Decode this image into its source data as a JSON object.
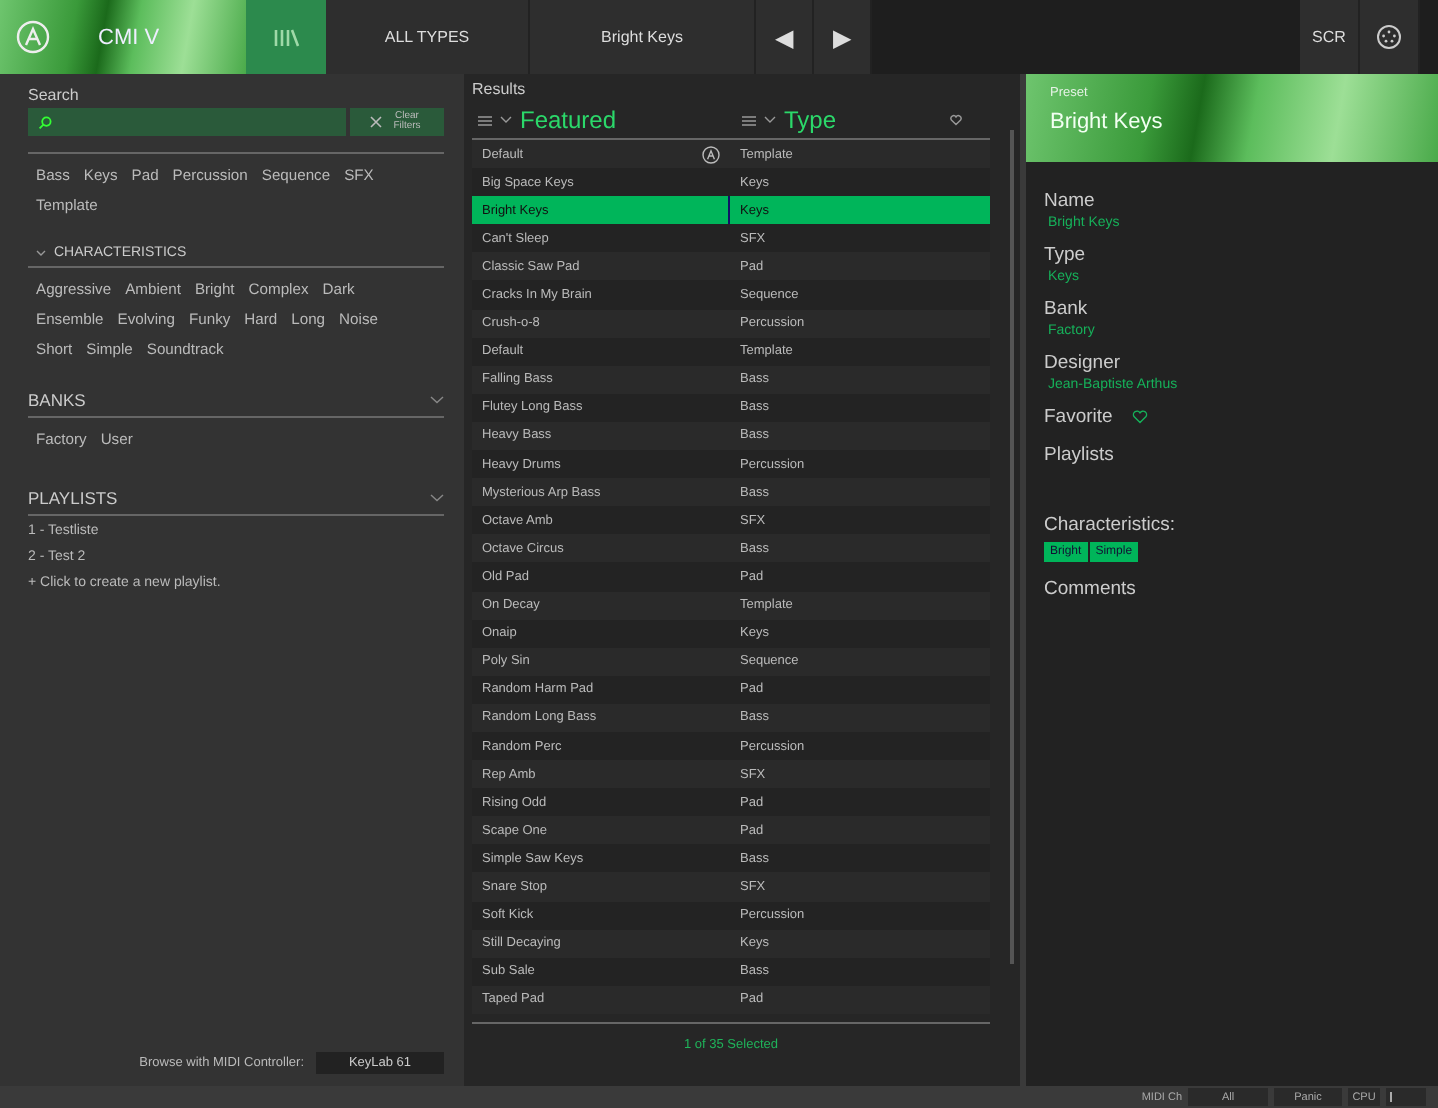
{
  "top_bar": {
    "instrument": "CMI V",
    "type_filter": "ALL TYPES",
    "preset": "Bright Keys",
    "prev": "◀",
    "next": "▶",
    "scr": "SCR"
  },
  "sidebar": {
    "search_label": "Search",
    "clear_filters": "Clear Filters",
    "types": [
      "Bass",
      "Keys",
      "Pad",
      "Percussion",
      "Sequence",
      "SFX",
      "Template"
    ],
    "characteristics": {
      "title": "CHARACTERISTICS",
      "expanded": true,
      "items": [
        "Aggressive",
        "Ambient",
        "Bright",
        "Complex",
        "Dark",
        "Ensemble",
        "Evolving",
        "Funky",
        "Hard",
        "Long",
        "Noise",
        "Short",
        "Simple",
        "Soundtrack"
      ]
    },
    "banks": {
      "title": "BANKS",
      "items": [
        "Factory",
        "User"
      ]
    },
    "playlists": {
      "title": "PLAYLISTS",
      "items": [
        "1 - Testliste",
        "2 - Test 2"
      ],
      "create": "+ Click to create a new playlist."
    },
    "midi_label": "Browse with MIDI Controller:",
    "midi_controller": "KeyLab 61"
  },
  "results": {
    "title": "Results",
    "columns": [
      "Featured",
      "Type"
    ],
    "rows": [
      {
        "name": "Default",
        "type": "Template",
        "selected": false,
        "factory": true
      },
      {
        "name": "Big Space Keys",
        "type": "Keys",
        "selected": false,
        "factory": false
      },
      {
        "name": "Bright Keys",
        "type": "Keys",
        "selected": true,
        "factory": false
      },
      {
        "name": "Can't Sleep",
        "type": "SFX",
        "selected": false,
        "factory": false
      },
      {
        "name": "Classic Saw Pad",
        "type": "Pad",
        "selected": false,
        "factory": false
      },
      {
        "name": "Cracks In My Brain",
        "type": "Sequence",
        "selected": false,
        "factory": false
      },
      {
        "name": "Crush-o-8",
        "type": "Percussion",
        "selected": false,
        "factory": false
      },
      {
        "name": "Default",
        "type": "Template",
        "selected": false,
        "factory": false
      },
      {
        "name": "Falling Bass",
        "type": "Bass",
        "selected": false,
        "factory": false
      },
      {
        "name": "Flutey Long Bass",
        "type": "Bass",
        "selected": false,
        "factory": false
      },
      {
        "name": "Heavy Bass",
        "type": "Bass",
        "selected": false,
        "factory": false
      },
      {
        "name": "Heavy Drums",
        "type": "Percussion",
        "selected": false,
        "factory": false
      },
      {
        "name": "Mysterious Arp Bass",
        "type": "Bass",
        "selected": false,
        "factory": false
      },
      {
        "name": "Octave Amb",
        "type": "SFX",
        "selected": false,
        "factory": false
      },
      {
        "name": "Octave Circus",
        "type": "Bass",
        "selected": false,
        "factory": false
      },
      {
        "name": "Old Pad",
        "type": "Pad",
        "selected": false,
        "factory": false
      },
      {
        "name": "On Decay",
        "type": "Template",
        "selected": false,
        "factory": false
      },
      {
        "name": "Onaip",
        "type": "Keys",
        "selected": false,
        "factory": false
      },
      {
        "name": "Poly Sin",
        "type": "Sequence",
        "selected": false,
        "factory": false
      },
      {
        "name": "Random Harm Pad",
        "type": "Pad",
        "selected": false,
        "factory": false
      },
      {
        "name": "Random Long Bass",
        "type": "Bass",
        "selected": false,
        "factory": false
      },
      {
        "name": "Random Perc",
        "type": "Percussion",
        "selected": false,
        "factory": false
      },
      {
        "name": "Rep Amb",
        "type": "SFX",
        "selected": false,
        "factory": false
      },
      {
        "name": "Rising Odd",
        "type": "Pad",
        "selected": false,
        "factory": false
      },
      {
        "name": "Scape One",
        "type": "Pad",
        "selected": false,
        "factory": false
      },
      {
        "name": "Simple Saw Keys",
        "type": "Bass",
        "selected": false,
        "factory": false
      },
      {
        "name": "Snare Stop",
        "type": "SFX",
        "selected": false,
        "factory": false
      },
      {
        "name": "Soft Kick",
        "type": "Percussion",
        "selected": false,
        "factory": false
      },
      {
        "name": "Still Decaying",
        "type": "Keys",
        "selected": false,
        "factory": false
      },
      {
        "name": "Sub Sale",
        "type": "Bass",
        "selected": false,
        "factory": false
      },
      {
        "name": "Taped Pad",
        "type": "Pad",
        "selected": false,
        "factory": false
      }
    ],
    "footer": "1 of 35 Selected"
  },
  "preset": {
    "header_label": "Preset",
    "header_name": "Bright Keys",
    "fields": [
      {
        "label": "Name",
        "value": "Bright Keys"
      },
      {
        "label": "Type",
        "value": "Keys"
      },
      {
        "label": "Bank",
        "value": "Factory"
      },
      {
        "label": "Designer",
        "value": "Jean-Baptiste Arthus"
      }
    ],
    "favorite_label": "Favorite",
    "favorite": false,
    "playlists_label": "Playlists",
    "characteristics_label": "Characteristics:",
    "characteristics": [
      "Bright",
      "Simple"
    ],
    "comments_label": "Comments"
  },
  "status_bar": {
    "midi_label": "MIDI Ch",
    "midi_channel": "All",
    "panic": "Panic",
    "cpu": "CPU"
  }
}
